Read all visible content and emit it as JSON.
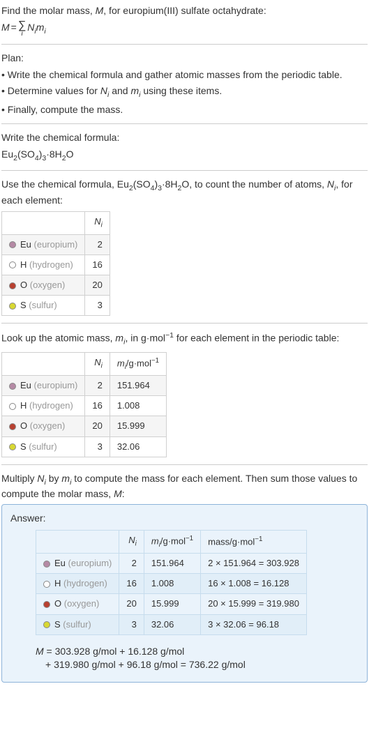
{
  "intro": {
    "line1_a": "Find the molar mass, ",
    "line1_b": ", for europium(III) sulfate octahydrate:",
    "formula_html": "M = ∑ Nᵢmᵢ",
    "M": "M",
    "eq": " = ",
    "sigma": "∑",
    "sigma_sub": "i",
    "Ni": "N",
    "Ni_sub": "i",
    "mi": "m",
    "mi_sub": "i"
  },
  "plan": {
    "heading": "Plan:",
    "b1": "• Write the chemical formula and gather atomic masses from the periodic table.",
    "b2_a": "• Determine values for ",
    "b2_b": " and ",
    "b2_c": " using these items.",
    "b3": "• Finally, compute the mass."
  },
  "write_formula": {
    "heading": "Write the chemical formula:",
    "formula": "Eu₂(SO₄)₃·8H₂O"
  },
  "count": {
    "line_a": "Use the chemical formula, ",
    "line_b": ", to count the number of atoms, ",
    "line_c": ", for each element:",
    "col_ni": "Nᵢ",
    "rows": [
      {
        "color": "#b58aa5",
        "label": "Eu",
        "dim": "(europium)",
        "n": "2"
      },
      {
        "color": "#ffffff",
        "label": "H",
        "dim": "(hydrogen)",
        "n": "16"
      },
      {
        "color": "#b84030",
        "label": "O",
        "dim": "(oxygen)",
        "n": "20"
      },
      {
        "color": "#d8d832",
        "label": "S",
        "dim": "(sulfur)",
        "n": "3"
      }
    ]
  },
  "lookup": {
    "line_a": "Look up the atomic mass, ",
    "line_b": ", in g·mol",
    "line_c": " for each element in the periodic table:",
    "neg1": "−1",
    "col_mi": "mᵢ/g·mol⁻¹",
    "rows": [
      {
        "color": "#b58aa5",
        "label": "Eu",
        "dim": "(europium)",
        "n": "2",
        "m": "151.964"
      },
      {
        "color": "#ffffff",
        "label": "H",
        "dim": "(hydrogen)",
        "n": "16",
        "m": "1.008"
      },
      {
        "color": "#b84030",
        "label": "O",
        "dim": "(oxygen)",
        "n": "20",
        "m": "15.999"
      },
      {
        "color": "#d8d832",
        "label": "S",
        "dim": "(sulfur)",
        "n": "3",
        "m": "32.06"
      }
    ]
  },
  "multiply": {
    "line_a": "Multiply ",
    "line_b": " by ",
    "line_c": " to compute the mass for each element. Then sum those values to compute the molar mass, ",
    "line_d": ":"
  },
  "answer": {
    "heading": "Answer:",
    "col_mass": "mass/g·mol⁻¹",
    "rows": [
      {
        "color": "#b58aa5",
        "label": "Eu",
        "dim": "(europium)",
        "n": "2",
        "m": "151.964",
        "mass": "2 × 151.964 = 303.928"
      },
      {
        "color": "#ffffff",
        "label": "H",
        "dim": "(hydrogen)",
        "n": "16",
        "m": "1.008",
        "mass": "16 × 1.008 = 16.128"
      },
      {
        "color": "#b84030",
        "label": "O",
        "dim": "(oxygen)",
        "n": "20",
        "m": "15.999",
        "mass": "20 × 15.999 = 319.980"
      },
      {
        "color": "#d8d832",
        "label": "S",
        "dim": "(sulfur)",
        "n": "3",
        "m": "32.06",
        "mass": "3 × 32.06 = 96.18"
      }
    ],
    "sum1": "M = 303.928 g/mol + 16.128 g/mol",
    "sum2": "+ 319.980 g/mol + 96.18 g/mol = 736.22 g/mol"
  },
  "chart_data": {
    "type": "table",
    "title": "Molar mass of europium(III) sulfate octahydrate Eu2(SO4)3·8H2O",
    "elements": [
      {
        "symbol": "Eu",
        "name": "europium",
        "N_i": 2,
        "m_i_g_per_mol": 151.964,
        "mass_g_per_mol": 303.928
      },
      {
        "symbol": "H",
        "name": "hydrogen",
        "N_i": 16,
        "m_i_g_per_mol": 1.008,
        "mass_g_per_mol": 16.128
      },
      {
        "symbol": "O",
        "name": "oxygen",
        "N_i": 20,
        "m_i_g_per_mol": 15.999,
        "mass_g_per_mol": 319.98
      },
      {
        "symbol": "S",
        "name": "sulfur",
        "N_i": 3,
        "m_i_g_per_mol": 32.06,
        "mass_g_per_mol": 96.18
      }
    ],
    "molar_mass_g_per_mol": 736.22
  }
}
